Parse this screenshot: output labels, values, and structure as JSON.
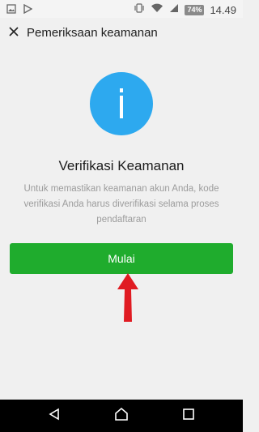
{
  "status_bar": {
    "battery": "74%",
    "time": "14.49",
    "icons": [
      "image-icon",
      "play-store-icon",
      "vibrate-icon",
      "wifi-icon",
      "signal-icon",
      "battery-icon"
    ]
  },
  "header": {
    "close_icon": "close-icon",
    "title": "Pemeriksaan keamanan"
  },
  "main": {
    "icon": "info-icon",
    "icon_color": "#2da9ef",
    "heading": "Verifikasi Keamanan",
    "description": "Untuk memastikan keamanan akun Anda, kode verifikasi Anda harus diverifikasi selama proses pendaftaran",
    "start_button": "Mulai",
    "button_color": "#1fac2d",
    "annotation": "red-arrow-icon"
  },
  "nav_bar": {
    "buttons": [
      "back-icon",
      "home-icon",
      "recents-icon"
    ]
  }
}
